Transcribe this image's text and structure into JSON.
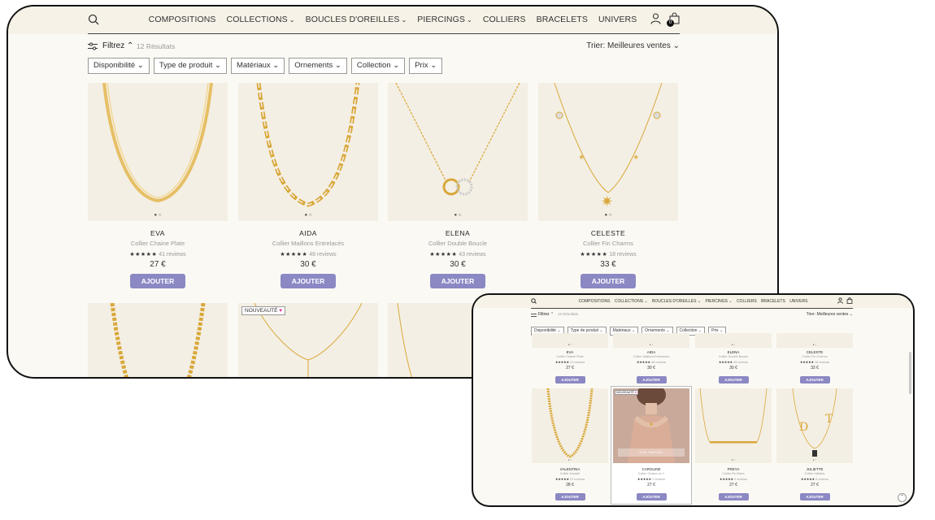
{
  "nav": {
    "items": [
      {
        "label": "COMPOSITIONS",
        "dropdown": false
      },
      {
        "label": "COLLECTIONS",
        "dropdown": true
      },
      {
        "label": "BOUCLES D'OREILLES",
        "dropdown": true
      },
      {
        "label": "PIERCINGS",
        "dropdown": true
      },
      {
        "label": "COLLIERS",
        "dropdown": false
      },
      {
        "label": "BRACELETS",
        "dropdown": false
      },
      {
        "label": "UNIVERS",
        "dropdown": false
      }
    ],
    "cart_count": "0",
    "icons": [
      "search-icon",
      "user-icon",
      "bag-icon"
    ]
  },
  "toolbar": {
    "filter_label": "Filtrez",
    "result_count": "12 Résultats",
    "sort_label": "Trier: Meilleures ventes"
  },
  "filters": [
    "Disponibilité",
    "Type de produit",
    "Matériaux",
    "Ornements",
    "Collection",
    "Prix"
  ],
  "products": [
    {
      "name": "EVA",
      "subtitle": "Collier Chaine Plate",
      "stars": "★★★★★",
      "reviews": "41 reviews",
      "price": "27 €",
      "button": "AJOUTER"
    },
    {
      "name": "AIDA",
      "subtitle": "Collier Maillons Entrelacés",
      "stars": "★★★★★",
      "reviews": "48 reviews",
      "price": "30 €",
      "button": "AJOUTER"
    },
    {
      "name": "ELENA",
      "subtitle": "Collier Double Boucle",
      "stars": "★★★★★",
      "reviews": "43 reviews",
      "price": "30 €",
      "button": "AJOUTER"
    },
    {
      "name": "CELESTE",
      "subtitle": "Collier Fin Charms",
      "stars": "★★★★★",
      "reviews": "18 reviews",
      "price": "33 €",
      "button": "AJOUTER"
    },
    {
      "name": "VALENTINA",
      "subtitle": "Collier torsadé",
      "stars": "★★★★★",
      "reviews": "21 reviews",
      "price": "28 €",
      "button": "AJOUTER"
    },
    {
      "name": "CAROLINE",
      "subtitle": "Collier Chaine en Y",
      "stars": "★★★★★",
      "reviews": "2 reviews",
      "price": "27 €",
      "button": "AJOUTER",
      "badge": "NOUVEAUTÉ",
      "quick_view": "VUE RAPIDE"
    },
    {
      "name": "FREYA",
      "subtitle": "Collier Fin Barre",
      "stars": "★★★★★",
      "reviews": "9 reviews",
      "price": "27 €",
      "button": "AJOUTER"
    },
    {
      "name": "JULIETTE",
      "subtitle": "Collier Initiales",
      "stars": "★★★★★",
      "reviews": "8 reviews",
      "price": "27 €",
      "button": "AJOUTER"
    }
  ],
  "badge_new": "NOUVEAUTÉ",
  "colors": {
    "button": "#8b88c4",
    "header_bg": "#f6f2e7",
    "image_bg": "#f4efe4",
    "gold": "#d9a83a",
    "badge_heart": "#e0308e"
  }
}
